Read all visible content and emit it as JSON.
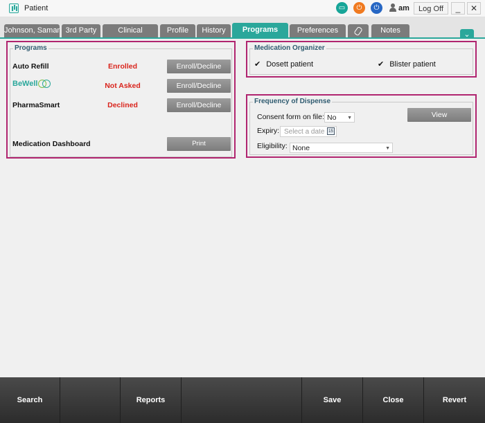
{
  "window": {
    "title": "Patient",
    "user": "am",
    "logoff_label": "Log Off",
    "minimize_glyph": "_",
    "close_glyph": "✕"
  },
  "tabs": [
    {
      "label": "Johnson, Saman",
      "active": false
    },
    {
      "label": "3rd Party",
      "active": false
    },
    {
      "label": "Clinical",
      "active": false
    },
    {
      "label": "Profile",
      "active": false
    },
    {
      "label": "History",
      "active": false
    },
    {
      "label": "Programs",
      "active": true
    },
    {
      "label": "Preferences",
      "active": false
    },
    {
      "label": "",
      "icon": "paperclip-icon",
      "active": false
    },
    {
      "label": "Notes",
      "active": false
    }
  ],
  "programs": {
    "legend": "Programs",
    "rows": [
      {
        "name": "Auto Refill",
        "status": "Enrolled",
        "button": "Enroll/Decline"
      },
      {
        "name": "BeWell",
        "status": "Not Asked",
        "button": "Enroll/Decline"
      },
      {
        "name": "PharmaSmart",
        "status": "Declined",
        "button": "Enroll/Decline"
      }
    ],
    "dashboard": {
      "label": "Medication Dashboard",
      "button": "Print"
    }
  },
  "medication_organizer": {
    "legend": "Medication Organizer",
    "dosett": {
      "label": "Dosett patient",
      "checked": true
    },
    "blister": {
      "label": "Blister patient",
      "checked": true
    }
  },
  "frequency": {
    "legend": "Frequency of Dispense",
    "consent_label": "Consent form on file:",
    "consent_value": "No",
    "view_button": "View",
    "expiry_label": "Expiry:",
    "expiry_placeholder": "Select a date",
    "eligibility_label": "Eligibility:",
    "eligibility_value": "None"
  },
  "footer": {
    "search": "Search",
    "reports": "Reports",
    "save": "Save",
    "close": "Close",
    "revert": "Revert"
  },
  "colors": {
    "accent": "#2aa79b",
    "highlight_border": "#b0246f",
    "status_red": "#d9241c"
  }
}
